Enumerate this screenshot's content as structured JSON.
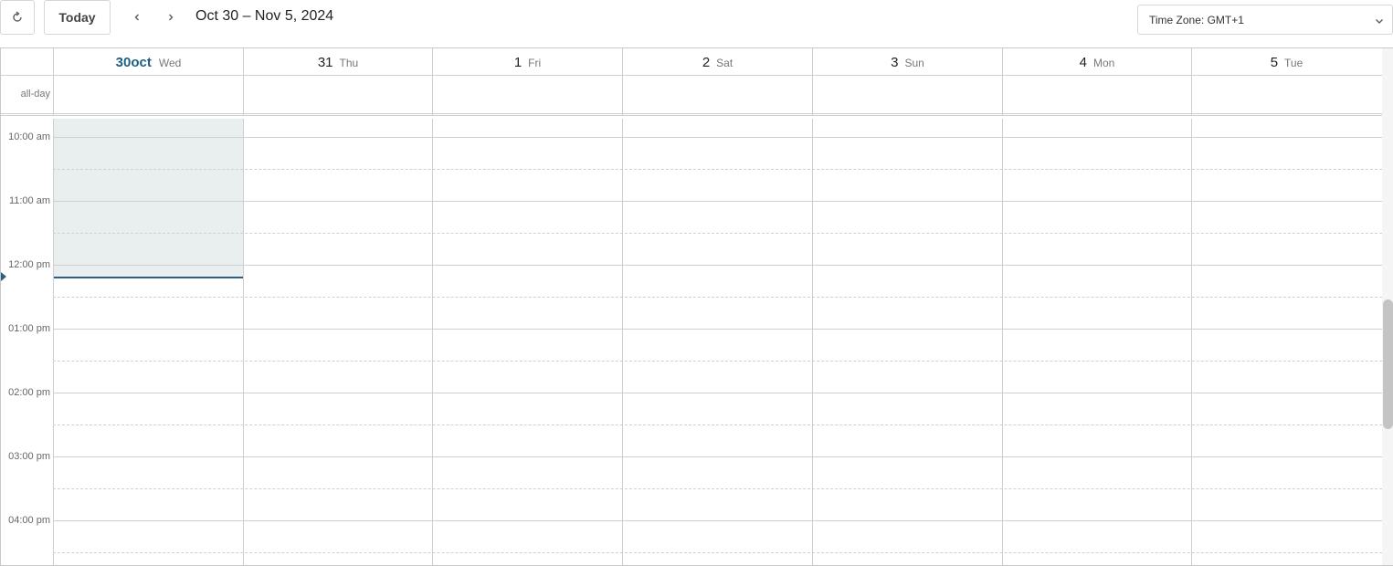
{
  "toolbar": {
    "refresh_icon": "refresh-icon",
    "today_label": "Today",
    "prev_icon": "chevron-left-icon",
    "next_icon": "chevron-right-icon",
    "date_range": "Oct 30 – Nov 5, 2024",
    "timezone_label": "Time Zone: GMT+1"
  },
  "calendar": {
    "all_day_label": "all-day",
    "days": [
      {
        "num": "30oct",
        "name": "Wed",
        "is_today": true
      },
      {
        "num": "31",
        "name": "Thu",
        "is_today": false
      },
      {
        "num": "1",
        "name": "Fri",
        "is_today": false
      },
      {
        "num": "2",
        "name": "Sat",
        "is_today": false
      },
      {
        "num": "3",
        "name": "Sun",
        "is_today": false
      },
      {
        "num": "4",
        "name": "Mon",
        "is_today": false
      },
      {
        "num": "5",
        "name": "Tue",
        "is_today": false
      }
    ],
    "hours": [
      "10:00 am",
      "11:00 am",
      "12:00 pm",
      "01:00 pm",
      "02:00 pm",
      "03:00 pm",
      "04:00 pm"
    ]
  },
  "colors": {
    "accent": "#1f5e83",
    "today_past_bg": "#e9eeee",
    "now_line": "#2c5f86"
  }
}
